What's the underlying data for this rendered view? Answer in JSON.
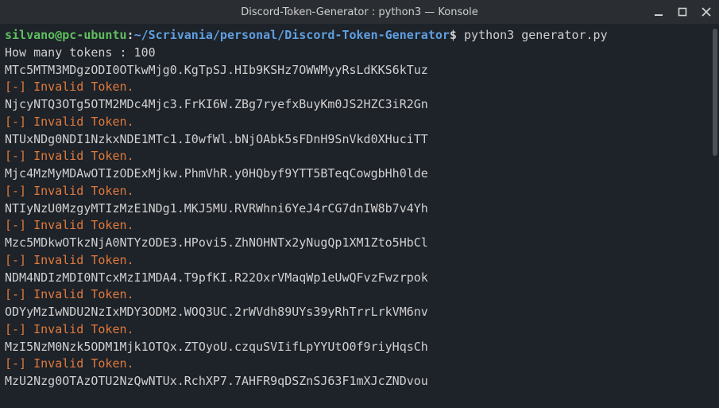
{
  "window": {
    "title": "Discord-Token-Generator : python3 — Konsole"
  },
  "prompt": {
    "user": "silvano",
    "at": "@",
    "host": "pc-ubuntu",
    "colon": ":",
    "path": "~/Scrivania/personal/Discord-Token-Generator",
    "dollar": "$",
    "command": " python3 generator.py"
  },
  "input_line": "How many tokens : 100",
  "invalid_msg": "[-] Invalid Token.",
  "tokens": [
    "MTc5MTM3MDgzODI0OTkwMjg0.KgTpSJ.HIb9KSHz7OWWMyyRsLdKKS6kTuz",
    "NjcyNTQ3OTg5OTM2MDc4Mjc3.FrKI6W.ZBg7ryefxBuyKm0JS2HZC3iR2Gn",
    "NTUxNDg0NDI1NzkxNDE1MTc1.I0wfWl.bNjOAbk5sFDnH9SnVkd0XHuciTT",
    "Mjc4MzMyMDAwOTIzODExMjkw.PhmVhR.y0HQbyf9YTT5BTeqCowgbHh0lde",
    "NTIyNzU0MzgyMTIzMzE1NDg1.MKJ5MU.RVRWhni6YeJ4rCG7dnIW8b7v4Yh",
    "Mzc5MDkwOTkzNjA0NTYzODE3.HPovi5.ZhNOHNTx2yNugQp1XM1Zto5HbCl",
    "NDM4NDIzMDI0NTcxMzI1MDA4.T9pfKI.R22OxrVMaqWp1eUwQFvzFwzrpok",
    "ODYyMzIwNDU2NzIxMDY3ODM2.WOQ3UC.2rWVdh89UYs39yRhTrrLrkVM6nv",
    "MzI5NzM0Nzk5ODM1Mjk1OTQx.ZTOyoU.czquSVIifLpYYUtO0f9riyHqsCh",
    "MzU2Nzg0OTAzOTU2NzQwNTUx.RchXP7.7AHFR9qDSZnSJ63F1mXJcZNDvou"
  ]
}
